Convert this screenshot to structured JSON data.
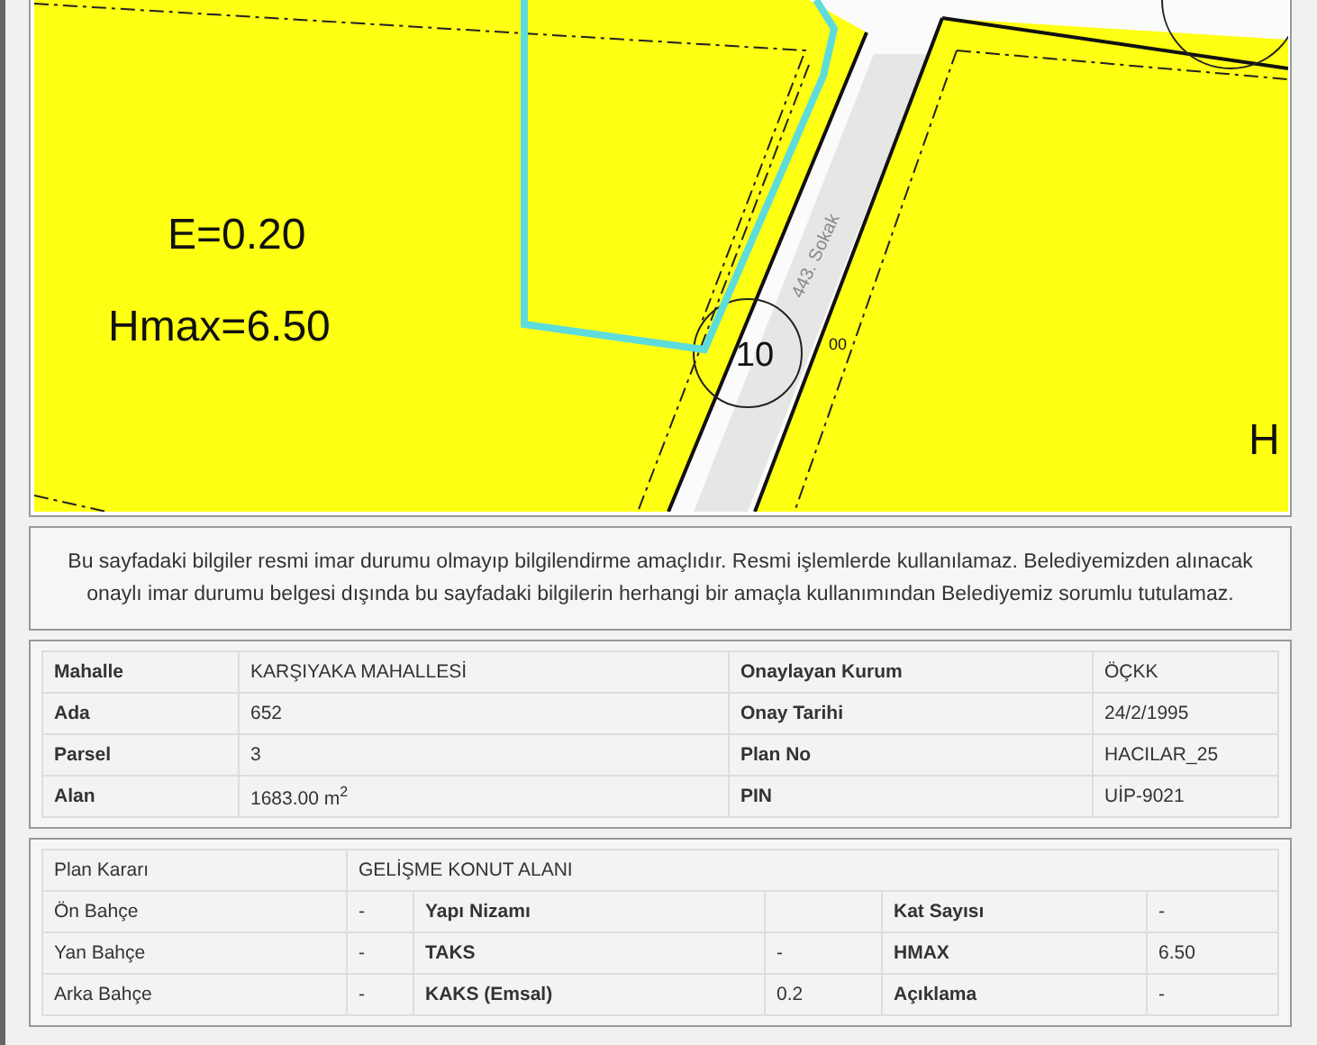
{
  "map": {
    "labels": [
      {
        "kind": "ratio",
        "text": "E=0.20"
      },
      {
        "kind": "height",
        "text": "Hmax=6.50"
      },
      {
        "kind": "parcel",
        "text": "10"
      },
      {
        "kind": "street",
        "text": "443. Sokak"
      },
      {
        "kind": "small",
        "text": "00"
      },
      {
        "kind": "edge",
        "text": "H"
      }
    ]
  },
  "notice": "Bu sayfadaki bilgiler resmi imar durumu olmayıp bilgilendirme amaçlıdır. Resmi işlemlerde kullanılamaz. Belediyemizden alınacak onaylı imar durumu belgesi dışında bu sayfadaki bilgilerin herhangi bir amaçla kullanımından Belediyemiz sorumlu tutulamaz.",
  "parcel_table": {
    "rows": [
      [
        "Mahalle",
        "KARŞIYAKA MAHALLESİ",
        "Onaylayan Kurum",
        "ÖÇKK"
      ],
      [
        "Ada",
        "652",
        "Onay Tarihi",
        "24/2/1995"
      ],
      [
        "Parsel",
        "3",
        "Plan No",
        "HACILAR_25"
      ],
      [
        "Alan",
        "1683.00 m$^{2}$",
        "PIN",
        "UİP-9021"
      ]
    ]
  },
  "plan_table": {
    "plan_decision": {
      "label": "Plan Kararı",
      "value": "GELİŞME KONUT ALANI"
    },
    "rows": [
      [
        "Ön Bahçe",
        "-",
        "Yapı Nizamı",
        null,
        "Kat Sayısı",
        "-"
      ],
      [
        "Yan Bahçe",
        "-",
        "TAKS",
        "-",
        "HMAX",
        "6.50"
      ],
      [
        "Arka Bahçe",
        "-",
        "KAKS (Emsal)",
        "0.2",
        "Açıklama",
        "-"
      ]
    ]
  }
}
